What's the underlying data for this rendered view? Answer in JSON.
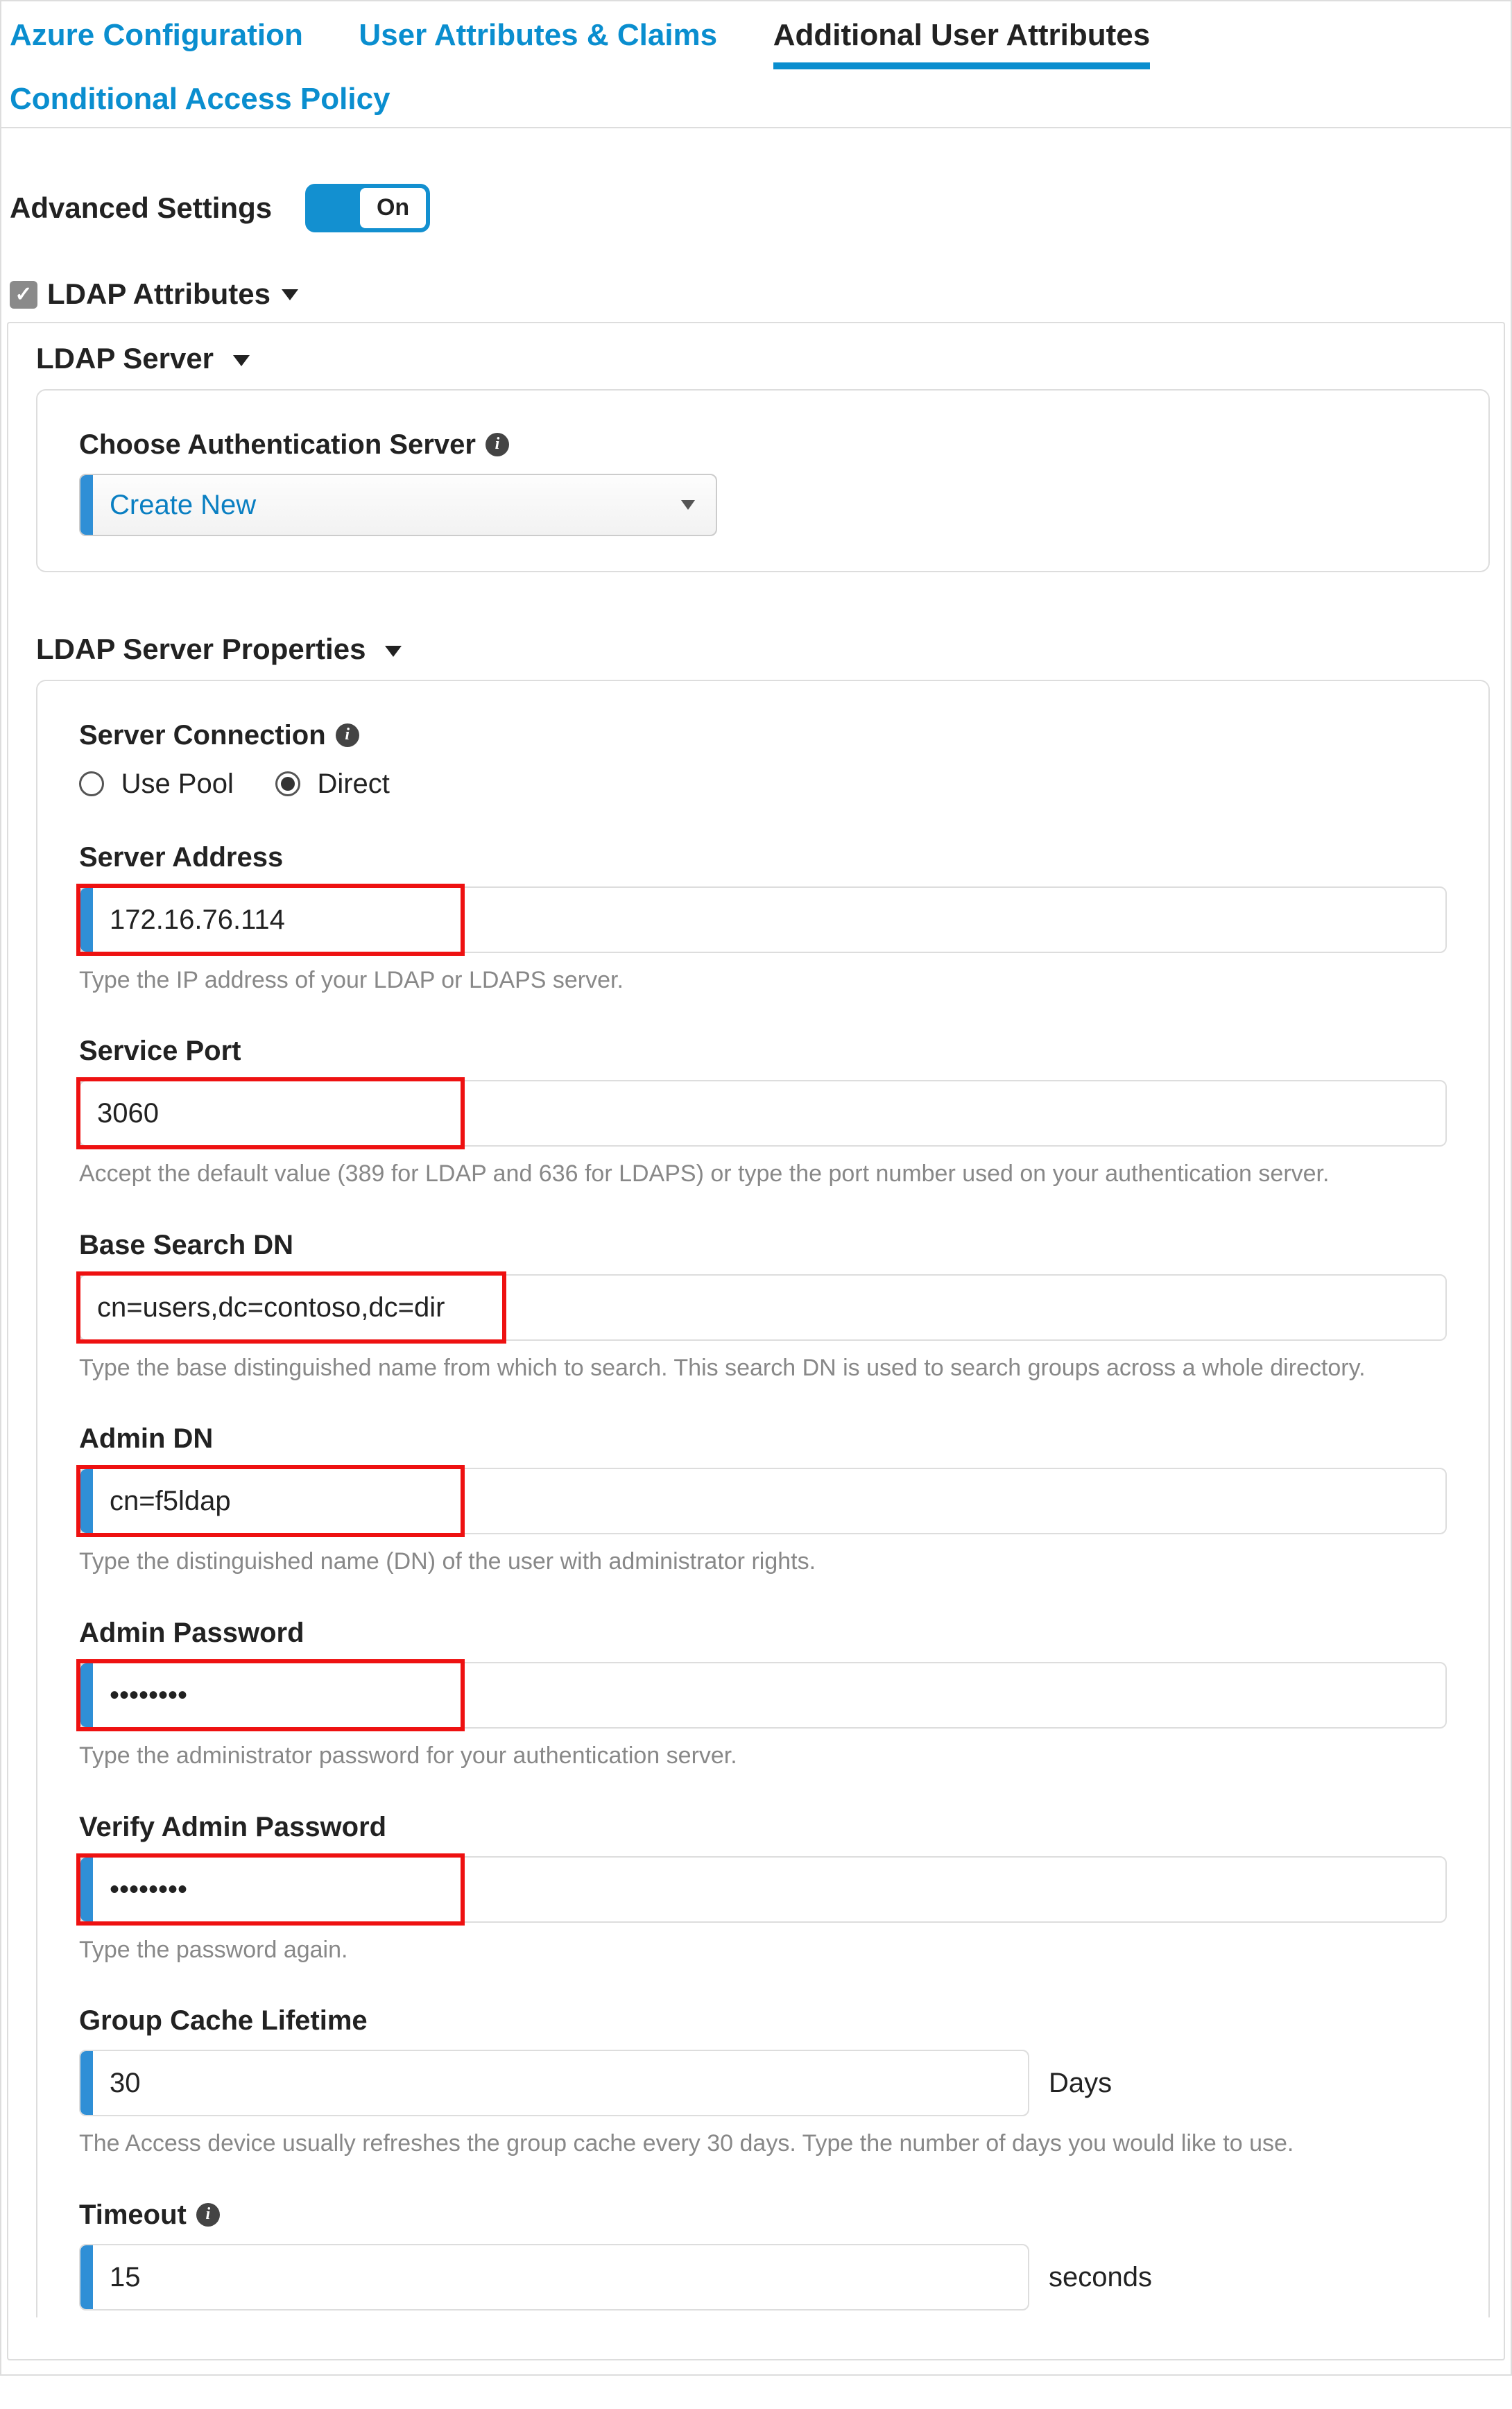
{
  "tabs": {
    "azure": "Azure Configuration",
    "claims": "User Attributes & Claims",
    "additional": "Additional User Attributes",
    "policy": "Conditional Access Policy"
  },
  "advanced": {
    "label": "Advanced Settings",
    "toggle": "On"
  },
  "ldap_attributes": {
    "title": "LDAP Attributes",
    "ldap_server": {
      "title": "LDAP Server",
      "choose_label": "Choose Authentication Server",
      "choose_value": "Create New"
    },
    "props": {
      "title": "LDAP Server Properties",
      "server_connection_label": "Server Connection",
      "radio_pool": "Use Pool",
      "radio_direct": "Direct",
      "server_address": {
        "label": "Server Address",
        "value": "172.16.76.114",
        "help": "Type the IP address of your LDAP or LDAPS server."
      },
      "service_port": {
        "label": "Service Port",
        "value": "3060",
        "help": "Accept the default value (389 for LDAP and 636 for LDAPS) or type the port number used on your authentication server."
      },
      "base_dn": {
        "label": "Base Search DN",
        "value": "cn=users,dc=contoso,dc=dir",
        "help": "Type the base distinguished name from which to search. This search DN is used to search groups across a whole directory."
      },
      "admin_dn": {
        "label": "Admin DN",
        "value": "cn=f5ldap",
        "help": "Type the distinguished name (DN) of the user with administrator rights."
      },
      "admin_pw": {
        "label": "Admin Password",
        "value": "••••••••",
        "help": "Type the administrator password for your authentication server."
      },
      "verify_pw": {
        "label": "Verify Admin Password",
        "value": "••••••••",
        "help": "Type the password again."
      },
      "cache": {
        "label": "Group Cache Lifetime",
        "value": "30",
        "unit": "Days",
        "help": "The Access device usually refreshes the group cache every 30 days. Type the number of days you would like to use."
      },
      "timeout": {
        "label": "Timeout",
        "value": "15",
        "unit": "seconds"
      }
    }
  }
}
